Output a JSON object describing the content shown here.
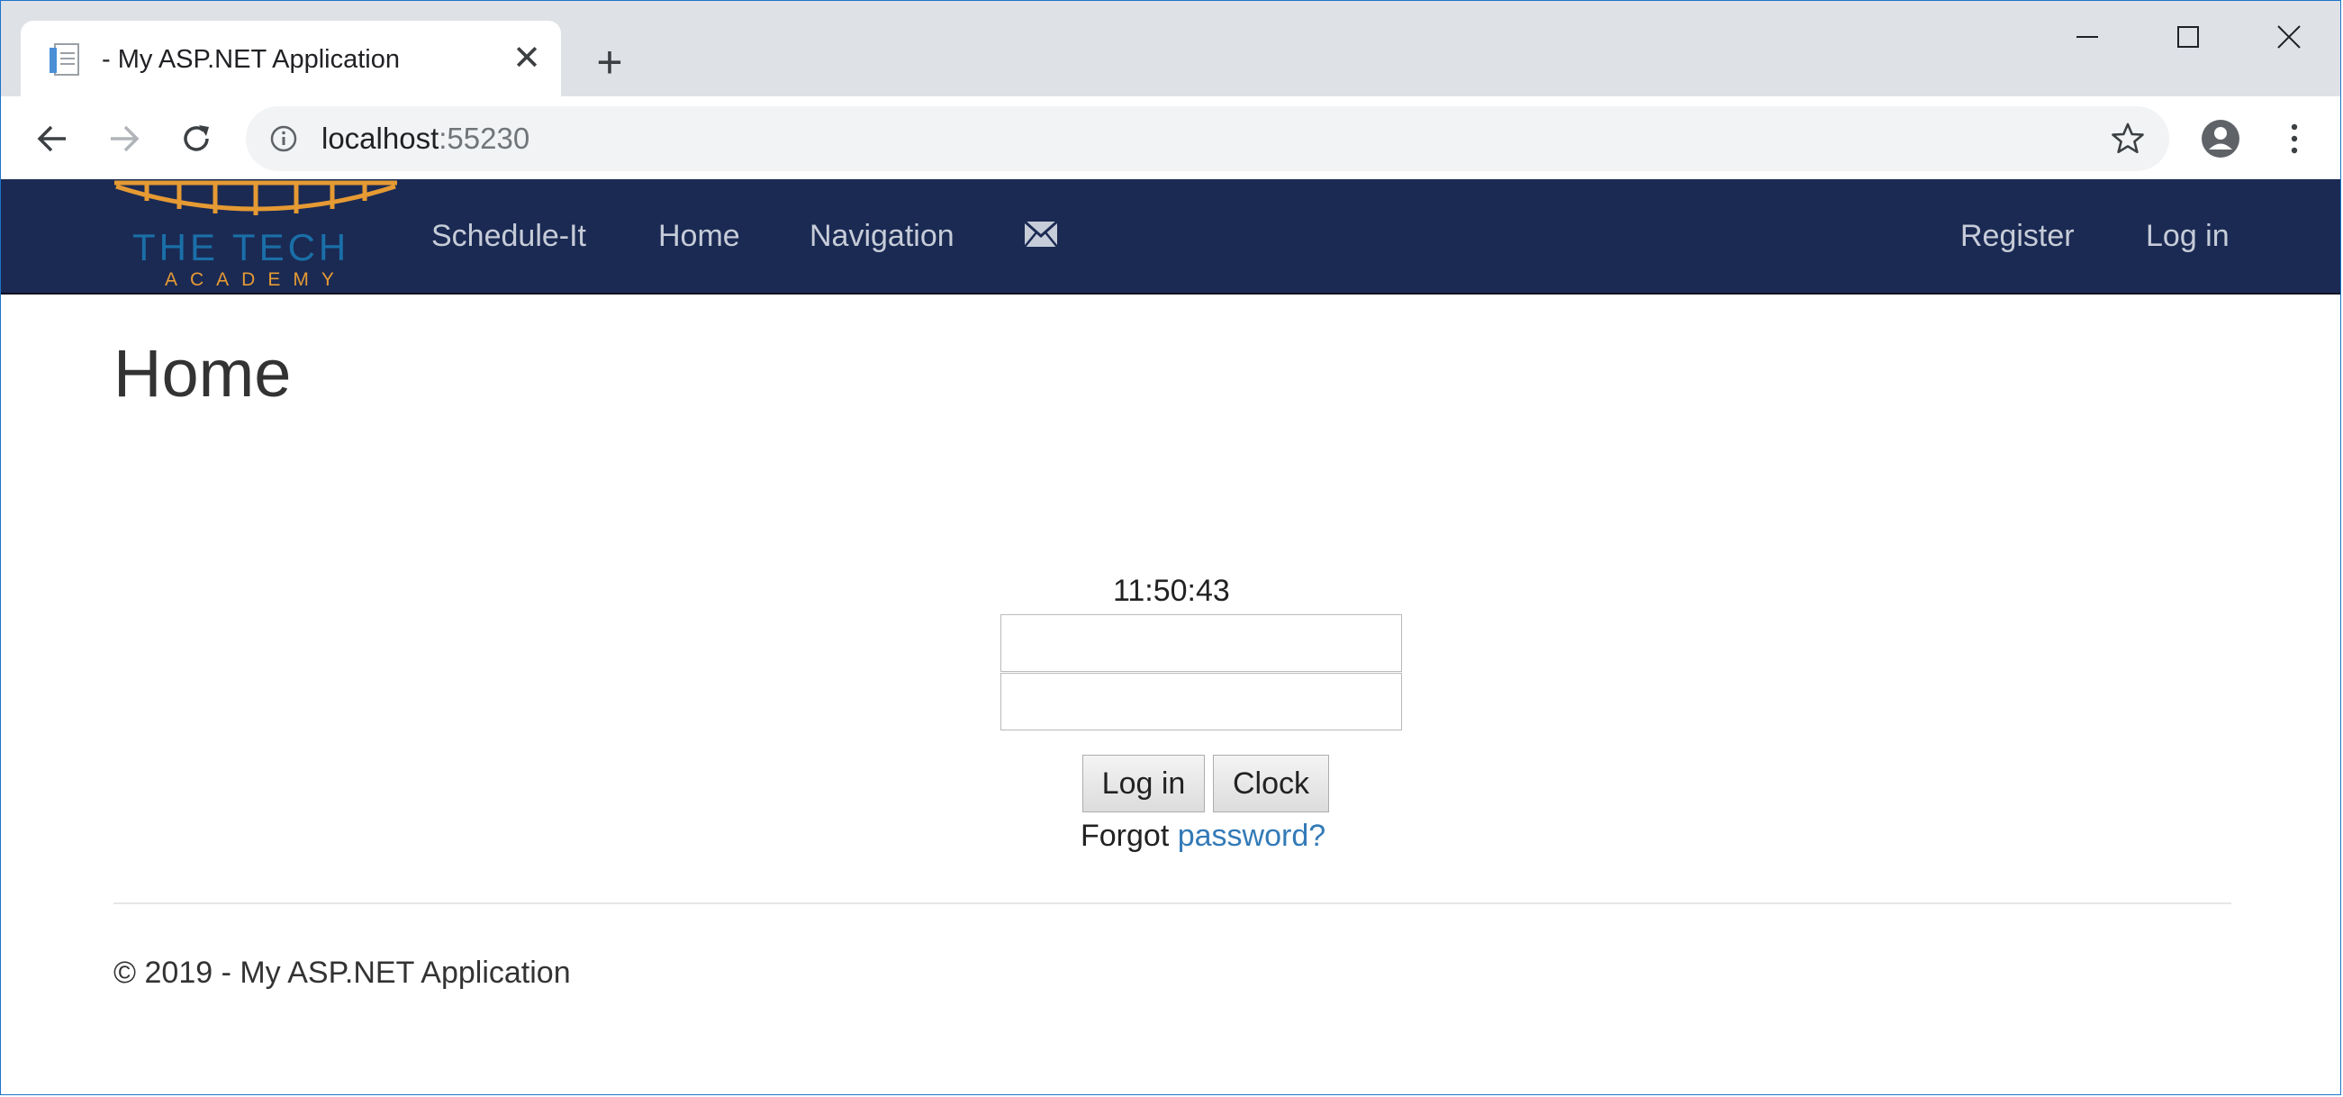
{
  "browser": {
    "tab": {
      "title": "- My ASP.NET Application",
      "close_label": "✕"
    },
    "new_tab_label": "+",
    "window_controls": {
      "minimize": "minimize-icon",
      "maximize": "maximize-icon",
      "close": "close-icon"
    },
    "address": {
      "host": "localhost",
      "port": ":55230"
    },
    "nav_icons": [
      "back-arrow-icon",
      "forward-arrow-icon",
      "reload-icon",
      "info-icon",
      "star-icon",
      "account-icon",
      "more-icon"
    ]
  },
  "navbar": {
    "logo": {
      "text": "THE TECH",
      "subtext": "ACADEMY"
    },
    "links": [
      "Schedule-It",
      "Home",
      "Navigation"
    ],
    "mail_icon": "envelope-icon",
    "right_links": [
      "Register",
      "Log in"
    ],
    "colors": {
      "background": "#1b2a53",
      "logo_orange": "#e59a33",
      "logo_blue": "#1a6fa8"
    }
  },
  "main": {
    "title": "Home",
    "clock": "11:50:43",
    "username_value": "",
    "password_value": "",
    "login_button": "Log in",
    "clock_button": "Clock",
    "forgot_prefix": "Forgot",
    "forgot_link": "password?"
  },
  "footer": {
    "text": "© 2019 - My ASP.NET Application"
  }
}
